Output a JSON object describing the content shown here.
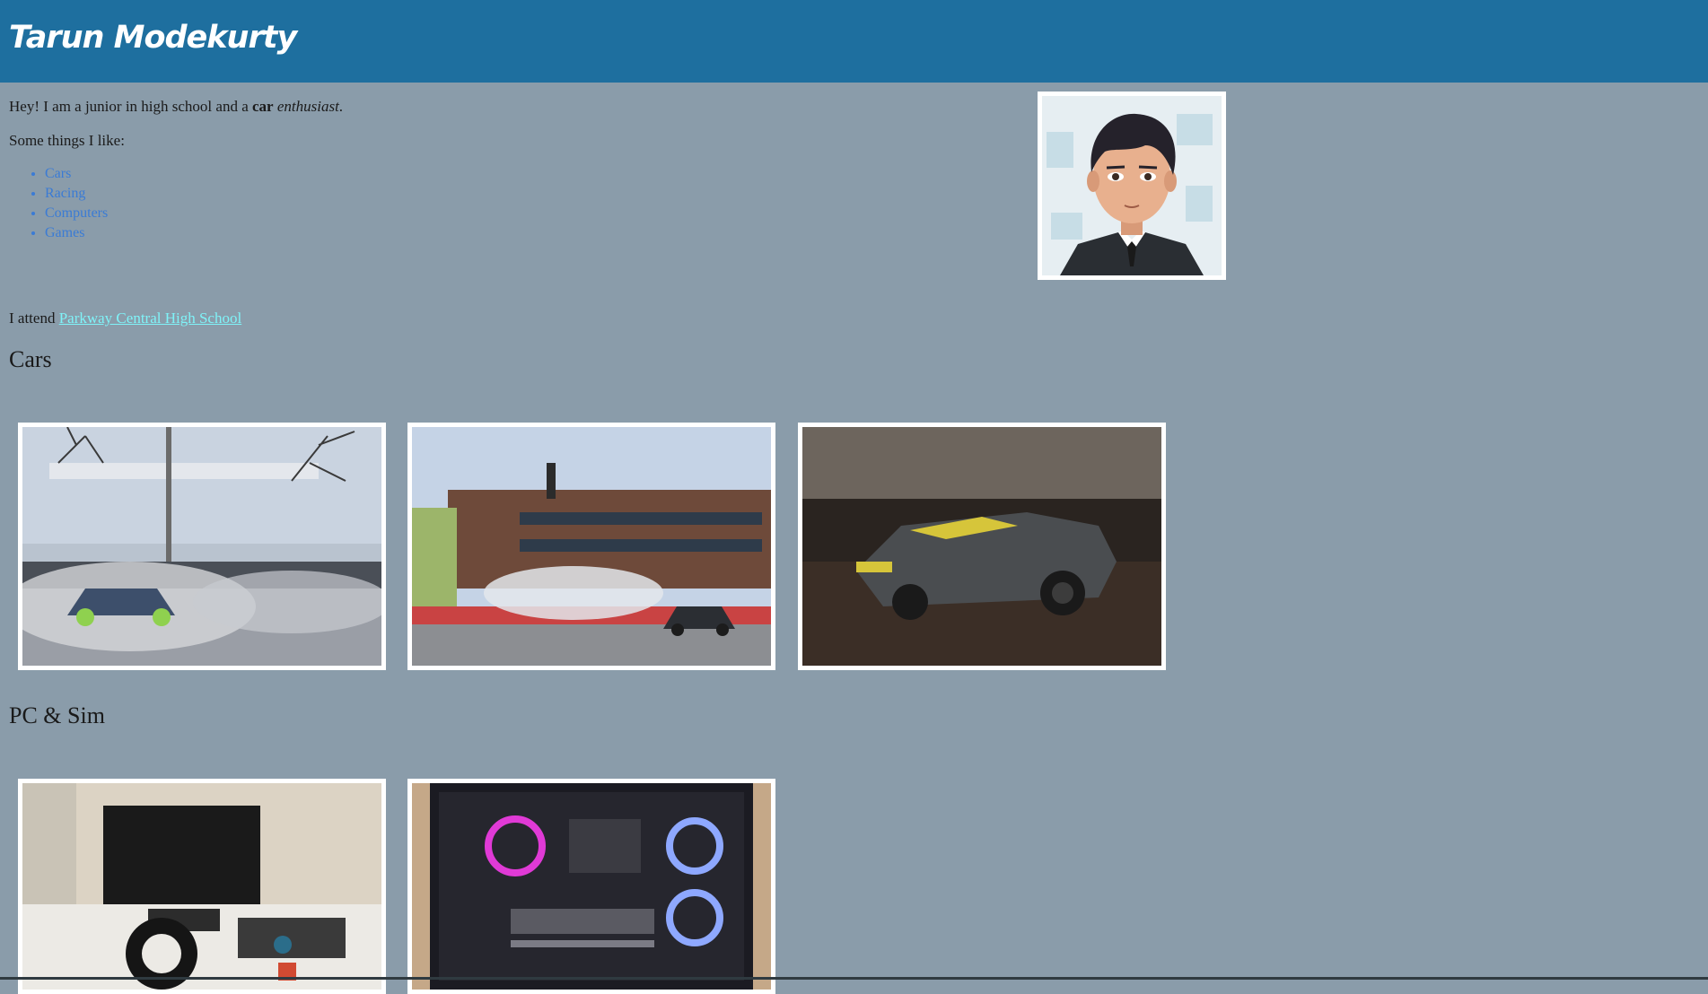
{
  "header": {
    "title": "Tarun Modekurty"
  },
  "intro": {
    "prefix": "Hey! I am a junior in high school and a ",
    "bold_word": "car",
    "space": " ",
    "italic_word": "enthusiast",
    "suffix": "."
  },
  "likes": {
    "label": "Some things I like:",
    "items": [
      "Cars",
      "Racing",
      "Computers",
      "Games"
    ]
  },
  "school": {
    "prefix": "I attend ",
    "link_text": "Parkway Central High School"
  },
  "sections": {
    "cars": "Cars",
    "pc": "PC & Sim"
  },
  "colors": {
    "header_bg": "#1e6f9f",
    "page_bg": "#8a9caa",
    "list_link": "#3a7bd5",
    "school_link": "#7ff3f8"
  }
}
